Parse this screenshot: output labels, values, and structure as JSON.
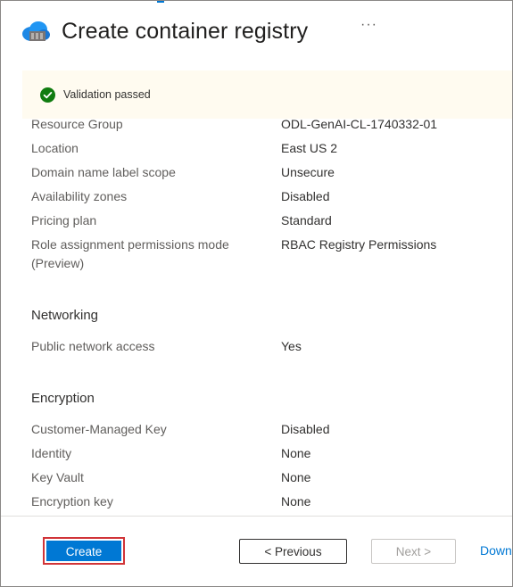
{
  "header": {
    "title": "Create container registry",
    "more_label": "···"
  },
  "banner": {
    "text": "Validation passed"
  },
  "details": [
    {
      "label": "Resource Group",
      "value": "ODL-GenAI-CL-1740332-01"
    },
    {
      "label": "Location",
      "value": "East US 2"
    },
    {
      "label": "Domain name label scope",
      "value": "Unsecure"
    },
    {
      "label": "Availability zones",
      "value": "Disabled"
    },
    {
      "label": "Pricing plan",
      "value": "Standard"
    },
    {
      "label": "Role assignment permissions mode (Preview)",
      "value": "RBAC Registry Permissions"
    }
  ],
  "networking": {
    "title": "Networking",
    "rows": [
      {
        "label": "Public network access",
        "value": "Yes"
      }
    ]
  },
  "encryption": {
    "title": "Encryption",
    "rows": [
      {
        "label": "Customer-Managed Key",
        "value": "Disabled"
      },
      {
        "label": "Identity",
        "value": "None"
      },
      {
        "label": "Key Vault",
        "value": "None"
      },
      {
        "label": "Encryption key",
        "value": "None"
      }
    ]
  },
  "footer": {
    "create_label": "Create",
    "previous_label": "< Previous",
    "next_label": "Next >",
    "download_label": "Down"
  },
  "icons": {
    "registry": "container-registry-cloud-icon",
    "check": "check-circle-icon"
  },
  "colors": {
    "accent": "#0078d4",
    "success": "#107c10",
    "highlight": "#d13438",
    "banner_bg": "#fffbf0"
  }
}
